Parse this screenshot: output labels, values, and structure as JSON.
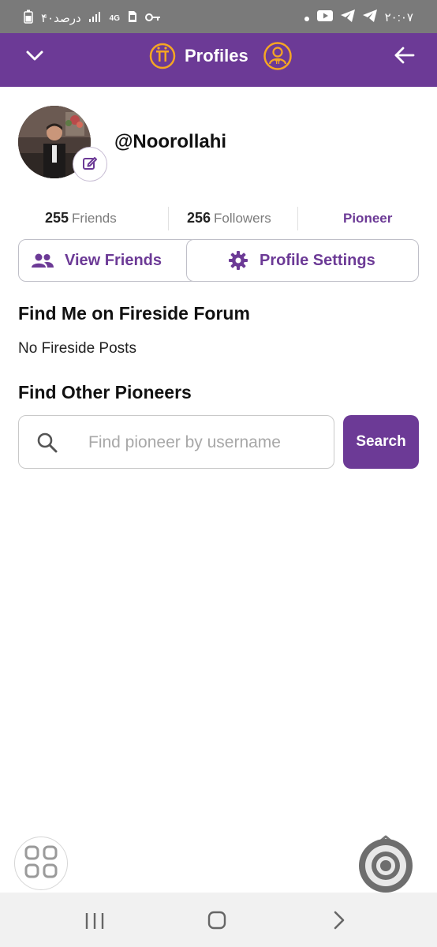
{
  "status_bar": {
    "left_text": "۴۰درصد",
    "network": "4G",
    "time": "۲۰:۰۷"
  },
  "header": {
    "title": "Profiles",
    "icons": [
      "chevron-down-icon",
      "pi-coin-icon",
      "pioneer-profile-icon",
      "back-arrow-icon"
    ]
  },
  "profile": {
    "username": "@Noorollahi",
    "friends_count": "255",
    "friends_label": "Friends",
    "followers_count": "256",
    "followers_label": "Followers",
    "role": "Pioneer"
  },
  "buttons": {
    "view_friends": "View Friends",
    "profile_settings": "Profile Settings"
  },
  "fireside": {
    "heading": "Find Me on Fireside Forum",
    "empty_text": "No Fireside Posts"
  },
  "find_pioneers": {
    "heading": "Find Other Pioneers",
    "search_placeholder": "Find pioneer by username",
    "search_value": "",
    "search_button": "Search"
  },
  "colors": {
    "brand_purple": "#6c3a96",
    "pi_gold": "#f5a623",
    "status_bar": "#7a7a7a"
  }
}
